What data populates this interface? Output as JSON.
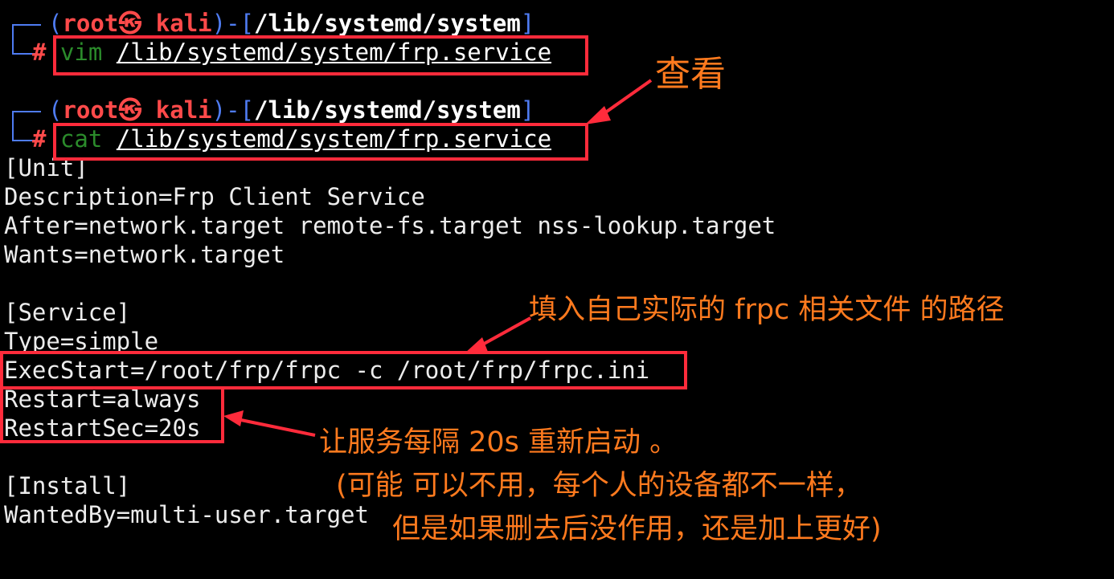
{
  "prompt1": {
    "user": "root",
    "host": "kali",
    "path": "/lib/systemd/system",
    "command": "vim",
    "arg": "/lib/systemd/system/frp.service"
  },
  "prompt2": {
    "user": "root",
    "host": "kali",
    "path": "/lib/systemd/system",
    "command": "cat",
    "arg": "/lib/systemd/system/frp.service"
  },
  "prompt_symbols": {
    "at": "㉿",
    "hash": "#",
    "open": "(",
    "close": ")",
    "dash": "-",
    "lbr": "[",
    "rbr": "]"
  },
  "output": {
    "unit": "[Unit]",
    "description": "Description=Frp Client Service",
    "after": "After=network.target remote-fs.target nss-lookup.target",
    "wants": "Wants=network.target",
    "service": "[Service]",
    "type": "Type=simple",
    "execstart": "ExecStart=/root/frp/frpc -c /root/frp/frpc.ini",
    "restart": "Restart=always",
    "restartsec": "RestartSec=20s",
    "install": "[Install]",
    "wantedby": "WantedBy=multi-user.target"
  },
  "annotations": {
    "view": "查看",
    "fill_path": "填入自己实际的 frpc 相关文件 的路径",
    "restart_note": "让服务每隔 20s 重新启动 。",
    "note_line2": "(可能 可以不用，每个人的设备都不一样，",
    "note_line3": "但是如果删去后没作用，还是加上更好)"
  },
  "colors": {
    "background": "#000000",
    "prompt_frame": "#4f7cf2",
    "user_host": "#ff4a4a",
    "command": "#2b8b2b",
    "annotation": "#ff7a1e",
    "highlight_box": "#ff2b3b"
  }
}
